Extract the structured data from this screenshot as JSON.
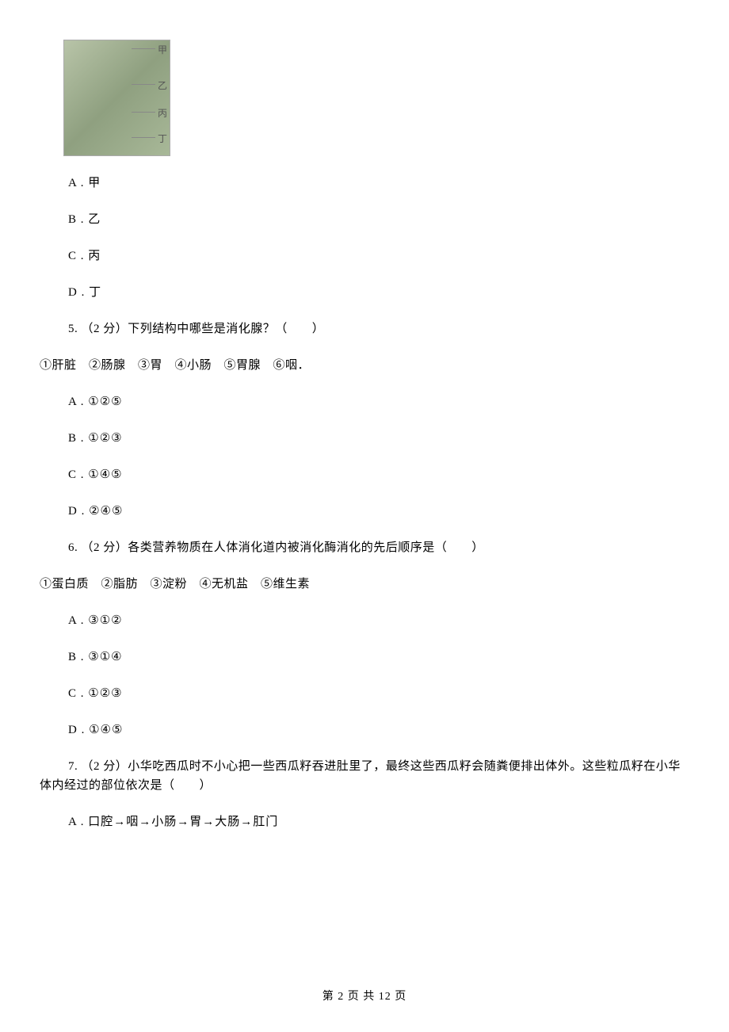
{
  "anatomy": {
    "label1": "甲",
    "label2": "乙",
    "label3": "丙",
    "label4": "丁"
  },
  "q4": {
    "optA": "A . 甲",
    "optB": "B . 乙",
    "optC": "C . 丙",
    "optD": "D . 丁"
  },
  "q5": {
    "stem": "5. （2 分）下列结构中哪些是消化腺？（　　）",
    "list": "①肝脏　②肠腺　③胃　④小肠　⑤胃腺　⑥咽．",
    "optA": "A . ①②⑤",
    "optB": "B . ①②③",
    "optC": "C . ①④⑤",
    "optD": "D . ②④⑤"
  },
  "q6": {
    "stem": "6. （2 分）各类营养物质在人体消化道内被消化酶消化的先后顺序是（　　）",
    "list": "①蛋白质　②脂肪　③淀粉　④无机盐　⑤维生素",
    "optA": "A . ③①②",
    "optB": "B . ③①④",
    "optC": "C . ①②③",
    "optD": "D . ①④⑤"
  },
  "q7": {
    "stem": "7. （2 分）小华吃西瓜时不小心把一些西瓜籽吞进肚里了，最终这些西瓜籽会随粪便排出体外。这些粒瓜籽在小华体内经过的部位依次是（　　）",
    "optA": "A . 口腔→咽→小肠→胃→大肠→肛门"
  },
  "footer": "第 2 页 共 12 页"
}
